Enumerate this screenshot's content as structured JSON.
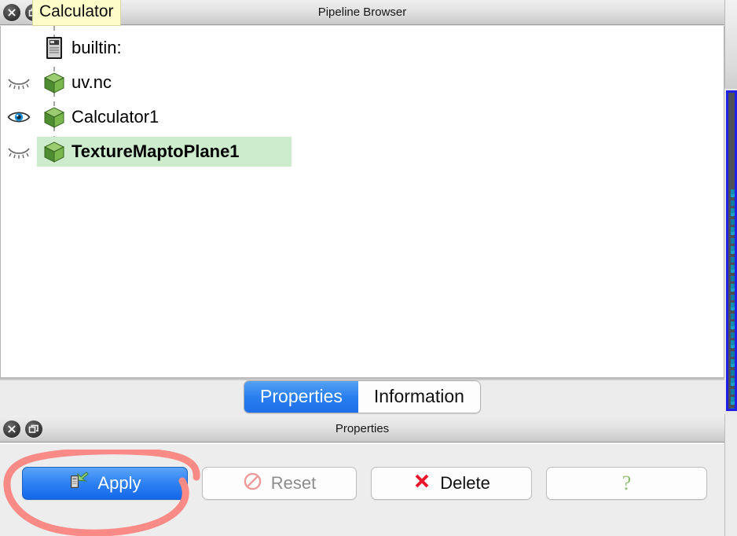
{
  "tooltip": {
    "text": "Calculator"
  },
  "pipeline": {
    "title": "Pipeline Browser",
    "close_icon": "close-icon",
    "float_icon": "undock-icon",
    "items": [
      {
        "label": "builtin:",
        "icon": "server-icon",
        "visibility": "none",
        "selected": false
      },
      {
        "label": "uv.nc",
        "icon": "source-cube-icon",
        "visibility": "hidden",
        "selected": false
      },
      {
        "label": "Calculator1",
        "icon": "source-cube-icon",
        "visibility": "visible",
        "selected": false
      },
      {
        "label": "TextureMaptoPlane1",
        "icon": "source-cube-icon",
        "visibility": "hidden",
        "selected": true
      }
    ]
  },
  "tabs": [
    {
      "label": "Properties",
      "active": true
    },
    {
      "label": "Information",
      "active": false
    }
  ],
  "properties": {
    "title": "Properties",
    "buttons": {
      "apply": {
        "label": "Apply",
        "icon": "apply-server-arrow-icon",
        "enabled": true
      },
      "reset": {
        "label": "Reset",
        "icon": "reset-forbidden-icon",
        "enabled": false
      },
      "delete": {
        "label": "Delete",
        "icon": "delete-x-icon",
        "enabled": true
      },
      "help": {
        "label": "?",
        "icon": "help-question-icon",
        "enabled": true
      }
    }
  },
  "annotation": {
    "shape": "hand-drawn-ellipse",
    "color": "#f98a86",
    "target": "apply-button"
  },
  "colors": {
    "accent_blue": "#2f82f2",
    "selection_green": "#cdeccd",
    "tooltip_yellow": "#fdfdc9",
    "annotation_red": "#f98a86",
    "panel_gray": "#ececec",
    "renderview_border": "#1f1fe8"
  }
}
